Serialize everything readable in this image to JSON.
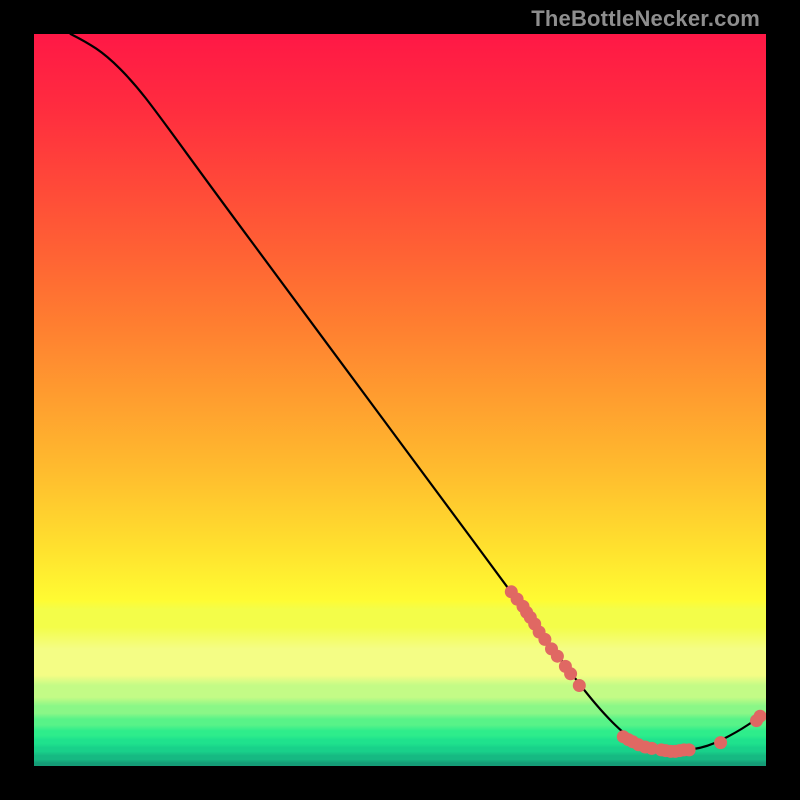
{
  "watermark": {
    "text": "TheBottleNecker.com"
  },
  "gradient": {
    "stops": [
      {
        "offset": 0.0,
        "color": "#ff1846"
      },
      {
        "offset": 0.1,
        "color": "#ff2c3f"
      },
      {
        "offset": 0.2,
        "color": "#ff4739"
      },
      {
        "offset": 0.3,
        "color": "#ff6234"
      },
      {
        "offset": 0.4,
        "color": "#ff7f30"
      },
      {
        "offset": 0.5,
        "color": "#ff9e2f"
      },
      {
        "offset": 0.6,
        "color": "#ffbd2e"
      },
      {
        "offset": 0.7,
        "color": "#ffe02e"
      },
      {
        "offset": 0.773,
        "color": "#fffb32"
      },
      {
        "offset": 0.786,
        "color": "#f3fd49"
      },
      {
        "offset": 0.81,
        "color": "#f3fd49"
      },
      {
        "offset": 0.84,
        "color": "#f4fd85"
      },
      {
        "offset": 0.876,
        "color": "#f4fd85"
      },
      {
        "offset": 0.89,
        "color": "#c3fb86"
      },
      {
        "offset": 0.906,
        "color": "#c3fb86"
      },
      {
        "offset": 0.918,
        "color": "#8af787"
      },
      {
        "offset": 0.928,
        "color": "#8af787"
      },
      {
        "offset": 0.936,
        "color": "#58f388"
      },
      {
        "offset": 0.944,
        "color": "#58f388"
      },
      {
        "offset": 0.952,
        "color": "#2eed8b"
      },
      {
        "offset": 0.958,
        "color": "#2eed8b"
      },
      {
        "offset": 0.964,
        "color": "#1fe28d"
      },
      {
        "offset": 0.969,
        "color": "#1fe28d"
      },
      {
        "offset": 0.975,
        "color": "#19d18a"
      },
      {
        "offset": 0.98,
        "color": "#19d18a"
      },
      {
        "offset": 0.986,
        "color": "#16b982"
      },
      {
        "offset": 0.991,
        "color": "#16b982"
      },
      {
        "offset": 0.996,
        "color": "#149c76"
      },
      {
        "offset": 1.0,
        "color": "#149c76"
      }
    ]
  },
  "marker_color": "#e06863",
  "chart_data": {
    "type": "line",
    "title": "",
    "xlabel": "",
    "ylabel": "",
    "xlim": [
      0,
      100
    ],
    "ylim": [
      0,
      100
    ],
    "curve": [
      {
        "x": 5.0,
        "y": 100.0
      },
      {
        "x": 7.0,
        "y": 99.0
      },
      {
        "x": 10.0,
        "y": 97.0
      },
      {
        "x": 13.5,
        "y": 93.5
      },
      {
        "x": 17.0,
        "y": 89.0
      },
      {
        "x": 25.0,
        "y": 78.0
      },
      {
        "x": 35.0,
        "y": 64.5
      },
      {
        "x": 45.0,
        "y": 51.0
      },
      {
        "x": 55.0,
        "y": 37.5
      },
      {
        "x": 65.0,
        "y": 24.0
      },
      {
        "x": 72.0,
        "y": 14.5
      },
      {
        "x": 77.0,
        "y": 8.0
      },
      {
        "x": 81.0,
        "y": 4.0
      },
      {
        "x": 84.0,
        "y": 2.3
      },
      {
        "x": 88.0,
        "y": 2.0
      },
      {
        "x": 92.0,
        "y": 2.6
      },
      {
        "x": 96.0,
        "y": 4.6
      },
      {
        "x": 99.0,
        "y": 6.6
      }
    ],
    "markers_upper": [
      {
        "x": 65.2,
        "y": 23.8
      },
      {
        "x": 66.0,
        "y": 22.8
      },
      {
        "x": 66.8,
        "y": 21.8
      },
      {
        "x": 67.3,
        "y": 21.0
      },
      {
        "x": 67.8,
        "y": 20.3
      },
      {
        "x": 68.4,
        "y": 19.4
      },
      {
        "x": 69.0,
        "y": 18.3
      },
      {
        "x": 69.8,
        "y": 17.3
      },
      {
        "x": 70.7,
        "y": 16.0
      },
      {
        "x": 71.5,
        "y": 15.0
      },
      {
        "x": 72.6,
        "y": 13.6
      },
      {
        "x": 73.3,
        "y": 12.6
      },
      {
        "x": 74.5,
        "y": 11.0
      }
    ],
    "markers_lower": [
      {
        "x": 80.5,
        "y": 4.0
      },
      {
        "x": 81.2,
        "y": 3.6
      },
      {
        "x": 81.8,
        "y": 3.3
      },
      {
        "x": 82.6,
        "y": 2.9
      },
      {
        "x": 83.5,
        "y": 2.6
      },
      {
        "x": 84.4,
        "y": 2.4
      },
      {
        "x": 85.7,
        "y": 2.2
      },
      {
        "x": 86.3,
        "y": 2.1
      },
      {
        "x": 87.0,
        "y": 2.0
      },
      {
        "x": 87.6,
        "y": 2.0
      },
      {
        "x": 88.2,
        "y": 2.1
      },
      {
        "x": 88.8,
        "y": 2.2
      },
      {
        "x": 89.5,
        "y": 2.2
      },
      {
        "x": 93.8,
        "y": 3.2
      },
      {
        "x": 98.7,
        "y": 6.2
      },
      {
        "x": 99.2,
        "y": 6.8
      }
    ]
  }
}
